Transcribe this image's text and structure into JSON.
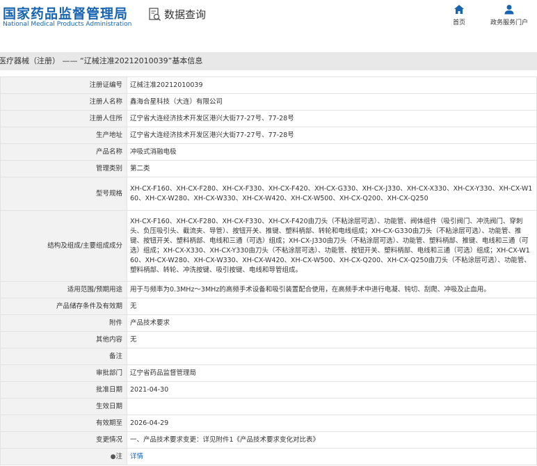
{
  "header": {
    "logo_cn": "国家药品监督管理局",
    "logo_en": "National Medical Products Administration",
    "query_title": "数据查询",
    "nav": [
      {
        "label": "首页",
        "icon": "home-icon"
      },
      {
        "label": "政务服务门户",
        "icon": "user-icon"
      }
    ]
  },
  "breadcrumb": "医疗器械（注册） —— “辽械注准20212010039”基本信息",
  "rows": [
    {
      "key": "注册证编号",
      "value": "辽械注准20212010039"
    },
    {
      "key": "注册人名称",
      "value": "鑫海合星科技（大连）有限公司"
    },
    {
      "key": "注册人住所",
      "value": "辽宁省大连经济技术开发区港兴大街77-27号、77-28号"
    },
    {
      "key": "生产地址",
      "value": "辽宁省大连经济技术开发区港兴大街77-27号、77-28号"
    },
    {
      "key": "产品名称",
      "value": "冲吸式消融电极"
    },
    {
      "key": "管理类别",
      "value": "第二类"
    },
    {
      "key": "型号规格",
      "value": "XH-CX-F160、XH-CX-F280、XH-CX-F330、XH-CX-F420、XH-CX-G330、XH-CX-J330、XH-CX-X330、XH-CX-Y330、XH-CX-W160、XH-CX-W280、XH-CX-W330、XH-CX-W420、XH-CX-W500、XH-CX-Q200、XH-CX-Q250"
    },
    {
      "key": "结构及组成/主要组成成分",
      "value": "XH-CX-F160、XH-CX-F280、XH-CX-F330、XH-CX-F420由刀头（不粘涂层可选）、功能管、阀体组件（吸引阀门、冲洗阀门、穿刺头、负压吸引头、截流夹、导管）、按钮开关、推键、塑料柄部、转轮和电线组成；XH-CX-G330由刀头（不粘涂层可选）、功能管、推键、按钮开关、塑料柄部、电线和三通（可选）组成；XH-CX-J330由刀头（不粘涂层可选）、功能管、塑料柄部、推键、电线和三通（可选）组成；XH-CX-X330、XH-CX-Y330由刀头（不粘涂层可选）、功能管、按钮开关、塑料柄部、电线和三通（可选）组成；XH-CX-W160、XH-CX-W280、XH-CX-W330、XH-CX-W420、XH-CX-W500、XH-CX-Q200、XH-CX-Q250由刀头（不粘涂层可选）、功能管、塑料柄部、转轮、冲洗按键、吸引按键、电线和导管组成。"
    },
    {
      "key": "适用范围/预期用途",
      "value": "用于与频率为0.3MHz～3MHz的高频手术设备和吸引装置配合使用，在高频手术中进行电凝、钝切、刮爬、冲吸及止血用。"
    },
    {
      "key": "产品储存条件及有效期",
      "value": "无"
    },
    {
      "key": "附件",
      "value": "产品技术要求"
    },
    {
      "key": "其他内容",
      "value": "无"
    },
    {
      "key": "备注",
      "value": ""
    },
    {
      "key": "审批部门",
      "value": "辽宁省药品监督管理局"
    },
    {
      "key": "批准日期",
      "value": "2021-04-30"
    },
    {
      "key": "生效日期",
      "value": ""
    },
    {
      "key": "有效期至",
      "value": "2026-04-29"
    },
    {
      "key": "变更情况",
      "value": "一、产品技术要求变更：详见附件1《产品技术要求变化对比表》"
    }
  ],
  "note_row": {
    "key": "注",
    "value": "详情"
  }
}
